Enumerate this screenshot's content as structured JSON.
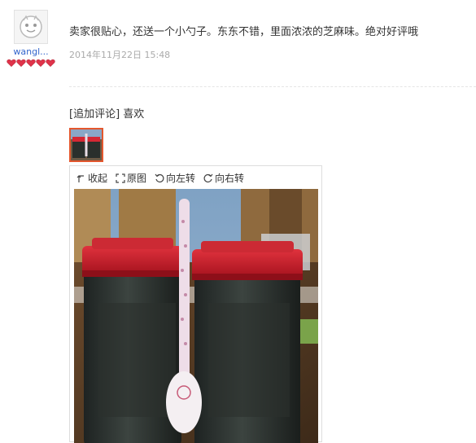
{
  "user": {
    "name": "wangl...",
    "avatar_icon": "default-avatar-icon",
    "level_icon": "red-heart-icon",
    "level_count": 5
  },
  "review": {
    "text": "卖家很贴心，还送一个小勺子。东东不错，里面浓浓的芝麻味。绝对好评哦",
    "date": "2014年11月22日 15:48"
  },
  "append": {
    "text": "[追加评论] 喜欢"
  },
  "viewer": {
    "collapse_label": "收起",
    "original_label": "原图",
    "rotate_left_label": "向左转",
    "rotate_right_label": "向右转"
  },
  "colors": {
    "link": "#3366cc",
    "date": "#aaaaaa",
    "thumb_border": "#e4572e",
    "heart": "#e0334a"
  }
}
